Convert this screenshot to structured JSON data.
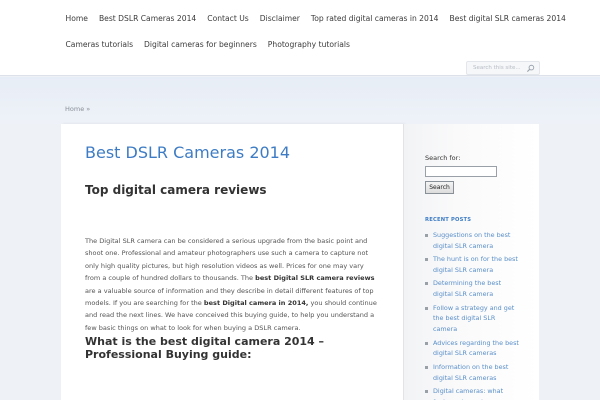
{
  "nav": {
    "row1": [
      "Home",
      "Best DSLR Cameras 2014",
      "Contact Us",
      "Disclaimer",
      "Top rated digital cameras in 2014",
      "Best digital SLR cameras 2014"
    ],
    "row2": [
      "Cameras tutorials",
      "Digital cameras for beginners",
      "Photography tutorials"
    ]
  },
  "search": {
    "placeholder": "Search this site..."
  },
  "breadcrumb": "Home »",
  "main": {
    "title": "Best DSLR Cameras 2014",
    "subtitle": "Top digital camera reviews",
    "body": {
      "p1": "The Digital SLR camera can be considered a serious upgrade from the basic point and shoot one. Professional and amateur photographers use such a camera to capture not only high quality pictures, but high resolution videos as well. Prices for one may vary from a couple of hundred dollars to thousands. The ",
      "b1": "best Digital SLR camera reviews",
      "p2": " are a valuable source of information and they describe in detail different features of top models. If you are searching for the ",
      "b2": "best Digital camera in 2014,",
      "p3": " you should continue and read the next lines. We have conceived this buying guide, to help you understand a few basic things on what to look for when buying a DSLR camera."
    },
    "heading2": "What is the best digital camera 2014 – Professional Buying guide:"
  },
  "sidebar": {
    "search_label": "Search for:",
    "search_button": "Search",
    "recent_title": "RECENT POSTS",
    "recent_posts": [
      "Suggestions on the best digital SLR camera",
      "The hunt is on for the best digital SLR camera",
      "Determining the best digital SLR camera",
      "Follow a strategy and get the best digital SLR camera",
      "Advices regarding the best digital SLR cameras",
      "Information on the best digital SLR cameras",
      "Digital cameras: what features to seek"
    ]
  }
}
